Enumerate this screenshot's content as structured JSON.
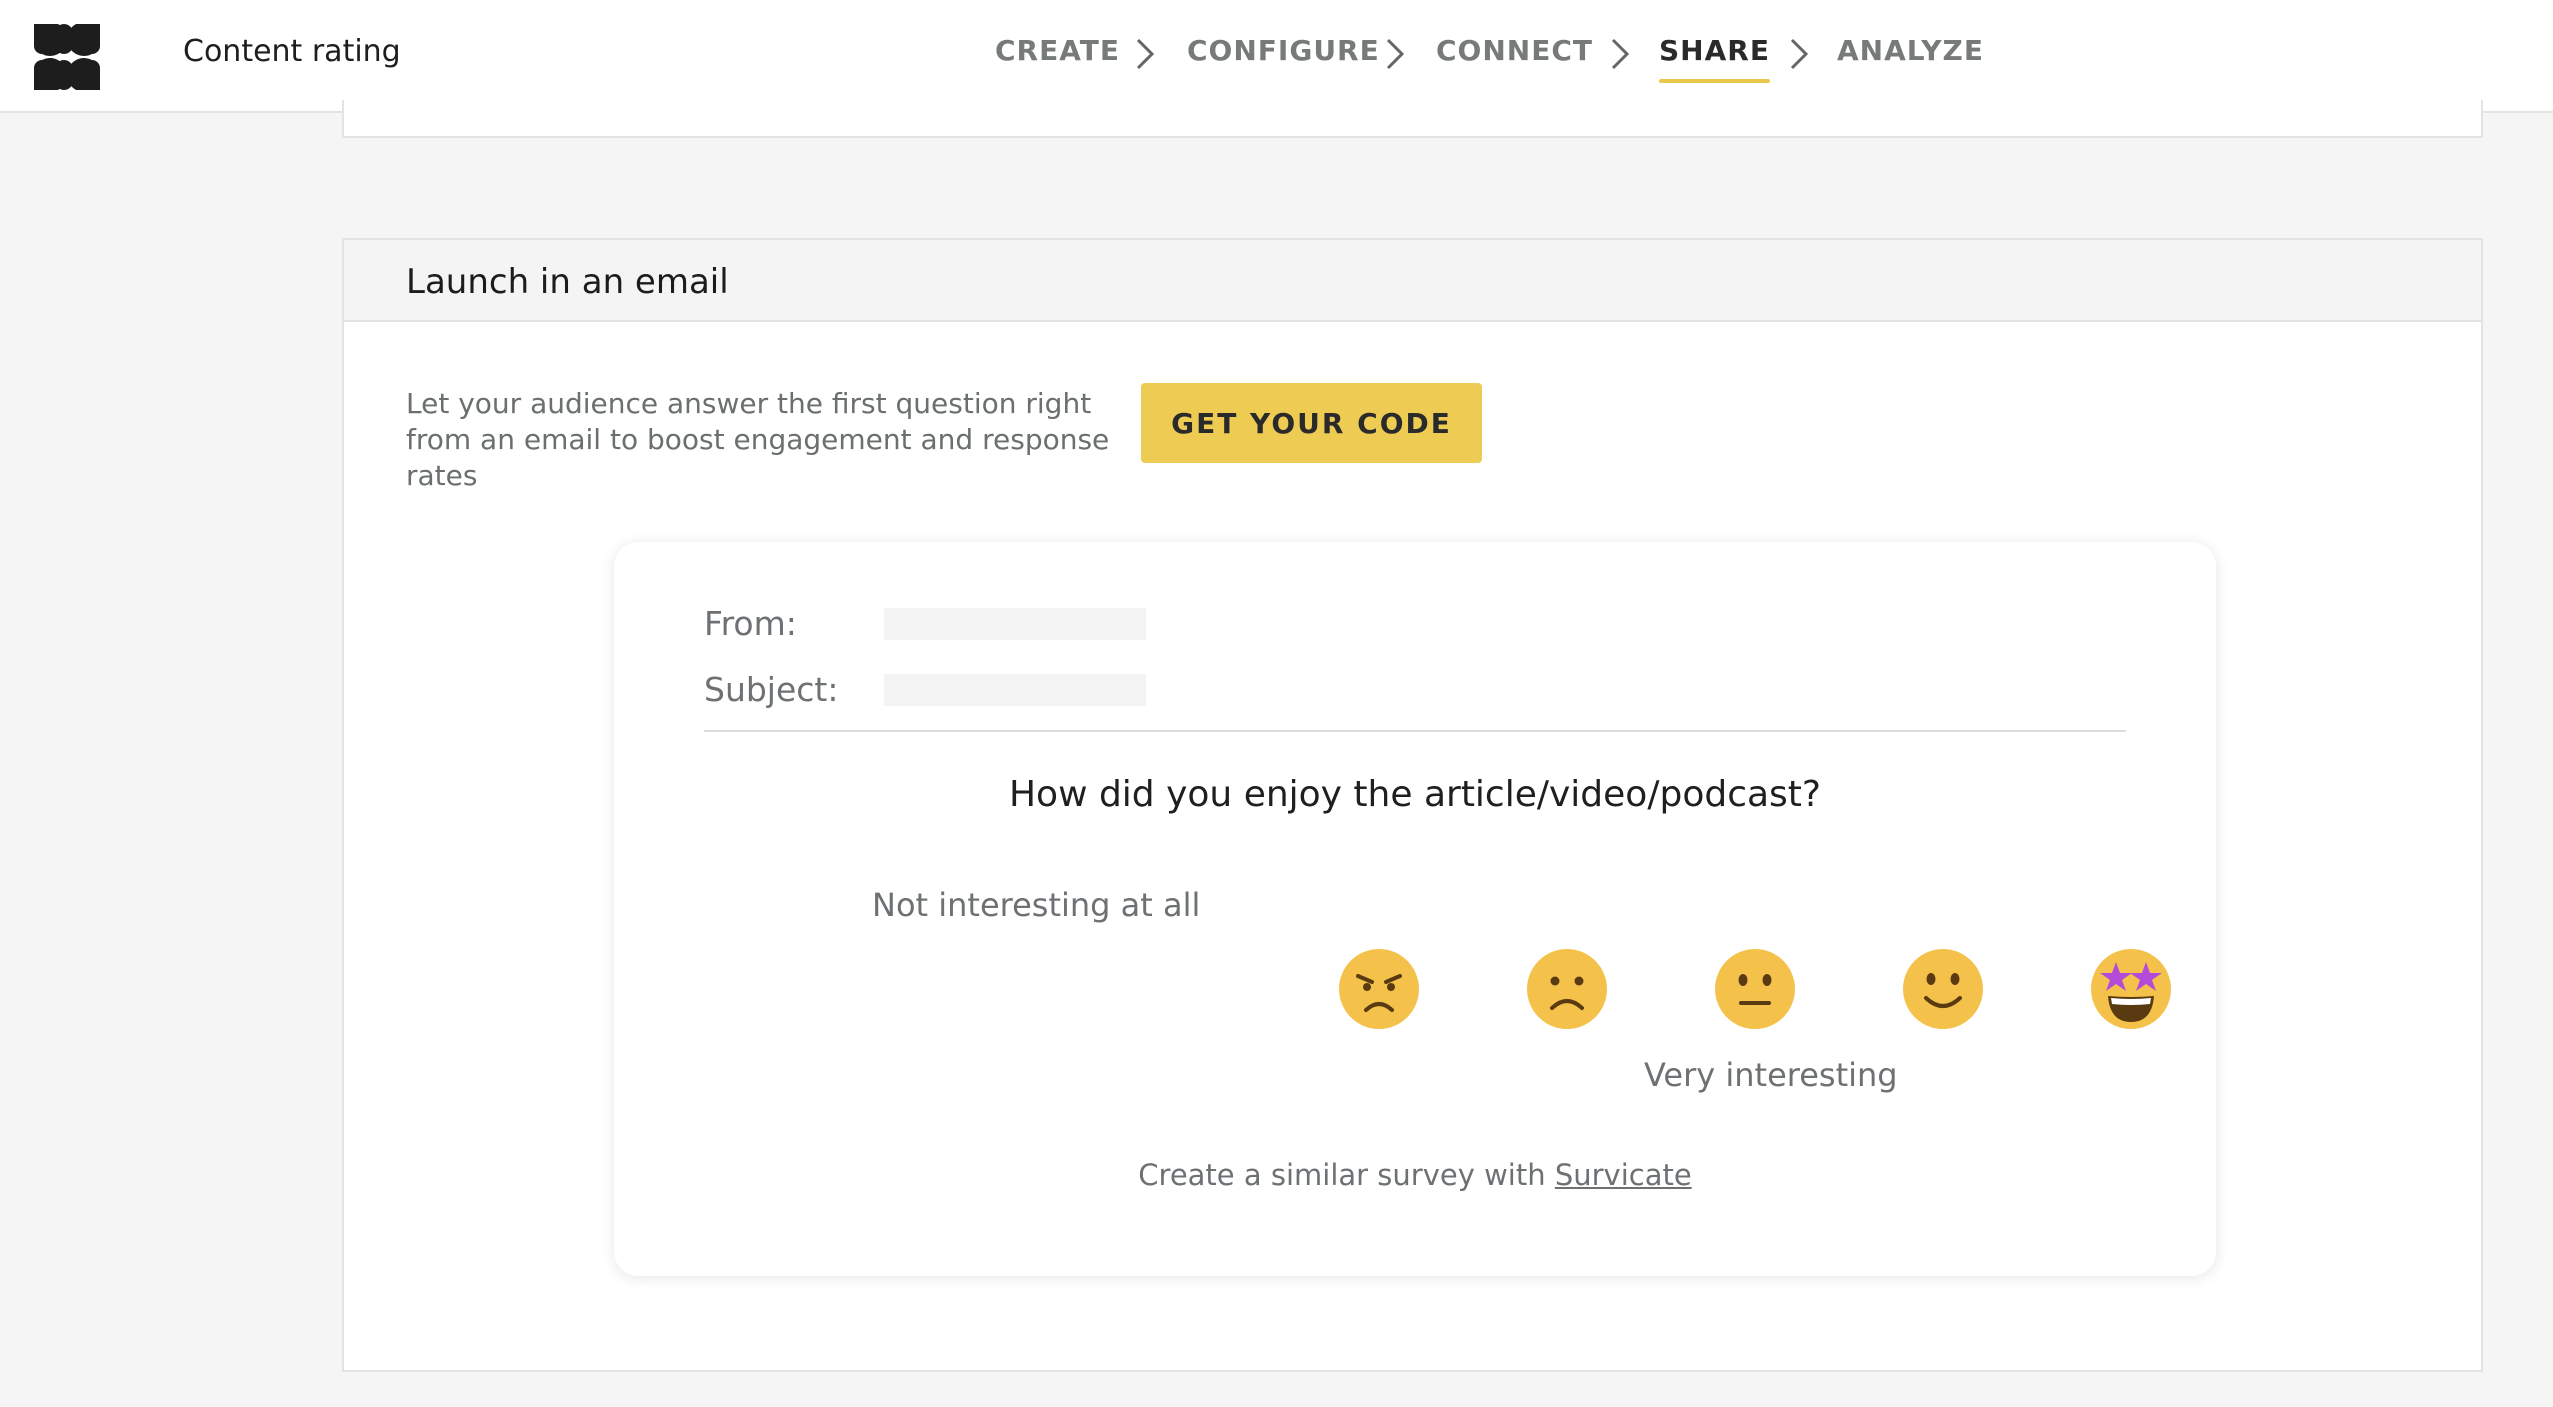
{
  "header": {
    "logo_icon": "survicate-logo-icon",
    "app_title": "Content rating",
    "steps": [
      {
        "label": "CREATE",
        "active": false
      },
      {
        "label": "CONFIGURE",
        "active": false
      },
      {
        "label": "CONNECT",
        "active": false
      },
      {
        "label": "SHARE",
        "active": true
      },
      {
        "label": "ANALYZE",
        "active": false
      }
    ],
    "separator_icon": "chevron-right-icon",
    "accent_color": "#e9c84b"
  },
  "email_section": {
    "title": "Launch in an email",
    "description": "Let your audience answer the first question right from an email to boost engagement and response rates",
    "button_label": "GET YOUR CODE",
    "button_color": "#eecb52"
  },
  "email_preview": {
    "from_label": "From:",
    "from_value": "",
    "subject_label": "Subject:",
    "subject_value": "",
    "question": "How did you enjoy the article/video/podcast?",
    "low_label": "Not interesting at all",
    "high_label": "Very interesting",
    "emojis": [
      {
        "name": "angry-face-icon"
      },
      {
        "name": "frowning-face-icon"
      },
      {
        "name": "neutral-face-icon"
      },
      {
        "name": "slightly-smiling-face-icon"
      },
      {
        "name": "star-struck-face-icon"
      }
    ],
    "footer_text": "Create a similar survey with ",
    "footer_link": "Survicate"
  }
}
